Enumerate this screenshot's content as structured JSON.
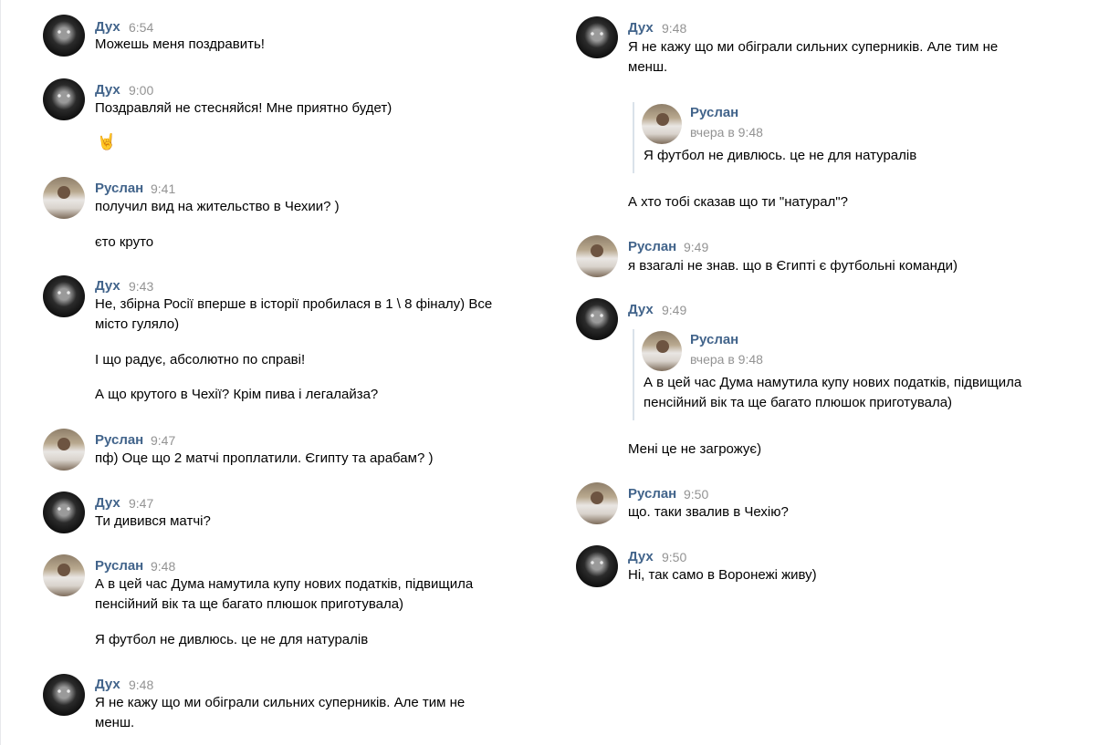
{
  "authors": {
    "dukh": "Дух",
    "ruslan": "Руслан"
  },
  "left": {
    "m1": {
      "author": "Дух",
      "time": "6:54",
      "text": "Можешь меня поздравить!"
    },
    "m2": {
      "author": "Дух",
      "time": "9:00",
      "text": "Поздравляй не стесняйся! Мне приятно будет)",
      "emoji": "🤘"
    },
    "m3": {
      "author": "Руслан",
      "time": "9:41",
      "text": "получил вид на жительство в Чехии? )",
      "text2": "єто круто"
    },
    "m4": {
      "author": "Дух",
      "time": "9:43",
      "text_l1": "Не, збірна Росії вперше в історії пробилася в 1 \\ 8 фіналу) Все",
      "text_l2": "місто гуляло)",
      "text2": "І що радує, абсолютно по справі!",
      "text3": "А що крутого в Чехії? Крім пива і легалайза?"
    },
    "m5": {
      "author": "Руслан",
      "time": "9:47",
      "text": "пф) Оце що 2 матчі проплатили. Єгипту та арабам? )"
    },
    "m6": {
      "author": "Дух",
      "time": "9:47",
      "text": "Ти дивився матчі?"
    },
    "m7": {
      "author": "Руслан",
      "time": "9:48",
      "text_l1": "А в цей час Дума намутила купу нових податків, підвищила",
      "text_l2": "пенсійний вік та ще багато плюшок приготувала)",
      "text2": "Я футбол не дивлюсь. це не для натуралів"
    },
    "m8": {
      "author": "Дух",
      "time": "9:48",
      "text_l1": "Я не кажу що ми обіграли сильних суперників. Але тим не",
      "text_l2": "менш."
    }
  },
  "right": {
    "m1": {
      "author": "Дух",
      "time": "9:48",
      "text_l1": "Я не кажу що ми обіграли сильних суперників. Але тим не",
      "text_l2": "менш.",
      "quote": {
        "author": "Руслан",
        "time": "вчера в 9:48",
        "text": "Я футбол не дивлюсь. це не для натуралів"
      },
      "text2": "А хто тобі сказав що ти \"натурал\"?"
    },
    "m2": {
      "author": "Руслан",
      "time": "9:49",
      "text": "я взагалі не знав. що в Єгипті є футбольні команди)"
    },
    "m3": {
      "author": "Дух",
      "time": "9:49",
      "quote": {
        "author": "Руслан",
        "time": "вчера в 9:48",
        "text_l1": "А в цей час Дума намутила купу нових податків, підвищила",
        "text_l2": "пенсійний вік та ще багато плюшок приготувала)"
      },
      "text2": "Мені це не загрожує)"
    },
    "m4": {
      "author": "Руслан",
      "time": "9:50",
      "text": "що. таки звалив в Чехію?"
    },
    "m5": {
      "author": "Дух",
      "time": "9:50",
      "text": "Ні, так само в Воронежі живу)"
    }
  },
  "colors": {
    "author": "#42648b",
    "time": "#939393",
    "text": "#000000",
    "quote_border": "#dae2ea"
  }
}
